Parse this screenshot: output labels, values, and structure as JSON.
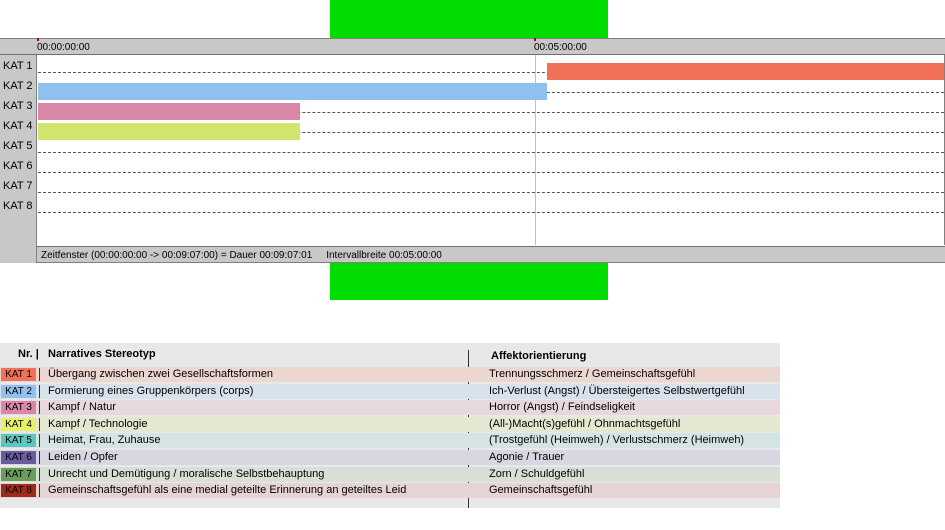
{
  "timeline": {
    "ticks": [
      "00:00:00:00",
      "00:05:00:00"
    ],
    "categories": [
      "KAT 1",
      "KAT 2",
      "KAT 3",
      "KAT 4",
      "KAT 5",
      "KAT 6",
      "KAT 7",
      "KAT 8"
    ],
    "intervals": [
      {
        "category": "KAT 1",
        "start": "00:05:07:00",
        "end": "00:09:07:00",
        "color": "#f07157"
      },
      {
        "category": "KAT 2",
        "start": "00:00:00:00",
        "end": "00:05:07:00",
        "color": "#90c0ee"
      },
      {
        "category": "KAT 3",
        "start": "00:00:00:00",
        "end": "00:02:38:00",
        "color": "#d887a6"
      },
      {
        "category": "KAT 4",
        "start": "00:00:00:00",
        "end": "00:02:38:00",
        "color": "#d2e36e"
      }
    ],
    "status_window": "Zeitfenster (00:00:00:00 -> 00:09:07:00) = Dauer 00:09:07:01",
    "status_interval": "Intervallbreite 00:05:00:00"
  },
  "legend": {
    "header_nr": "Nr. |",
    "header_stereotype": "Narratives Stereotyp",
    "header_affect": "Affektorientierung",
    "rows": [
      {
        "badge": "KAT 1",
        "badge_color": "#f07157",
        "row_color": "#ecd6d0",
        "stereotype": "Übergang zwischen zwei Gesellschaftsformen",
        "affect": "Trennungsschmerz / Gemeinschaftsgefühl"
      },
      {
        "badge": "KAT 2",
        "badge_color": "#90c0ee",
        "row_color": "#d8e2ec",
        "stereotype": "Formierung eines Gruppenkörpers (corps)",
        "affect": "Ich-Verlust (Angst) / Übersteigertes Selbstwertgefühl"
      },
      {
        "badge": "KAT 3",
        "badge_color": "#d887a6",
        "row_color": "#e8d8dd",
        "stereotype": "Kampf / Natur",
        "affect": "Horror (Angst) / Feindseligkeit"
      },
      {
        "badge": "KAT 4",
        "badge_color": "#e6f06a",
        "row_color": "#e4e8d0",
        "stereotype": "Kampf / Technologie",
        "affect": "(All-)Macht(s)gefühl / Ohnmachtsgefühl"
      },
      {
        "badge": "KAT 5",
        "badge_color": "#5ec6c0",
        "row_color": "#d4e4e2",
        "stereotype": "Heimat, Frau, Zuhause",
        "affect": "(Trostgefühl (Heimweh) / Verlustschmerz (Heimweh)"
      },
      {
        "badge": "KAT 6",
        "badge_color": "#6a5a9e",
        "row_color": "#d8d6e2",
        "stereotype": "Leiden / Opfer",
        "affect": "Agonie / Trauer"
      },
      {
        "badge": "KAT 7",
        "badge_color": "#6a9c5e",
        "row_color": "#d8e0d6",
        "stereotype": "Unrecht und Demütigung / moralische Selbstbehauptung",
        "affect": "Zorn / Schuldgefühl"
      },
      {
        "badge": "KAT 8",
        "badge_color": "#9e2b1a",
        "row_color": "#e6d4d4",
        "stereotype": "Gemeinschaftsgefühl als eine medial geteilte Erinnerung an geteiltes Leid",
        "affect": "Gemeinschaftsgefühl"
      }
    ]
  }
}
